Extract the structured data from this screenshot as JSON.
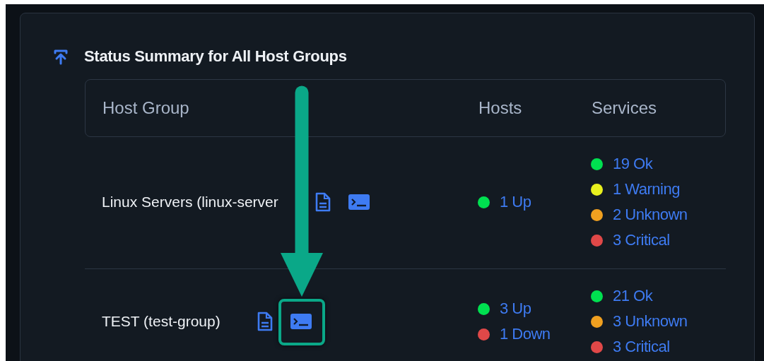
{
  "title": "Status Summary for All Host Groups",
  "columns": [
    "Host Group",
    "Hosts",
    "Services"
  ],
  "rows": [
    {
      "name": "Linux Servers (linux-server",
      "actions": [
        {
          "kind": "document",
          "highlighted": false
        },
        {
          "kind": "terminal",
          "highlighted": false
        }
      ],
      "hosts": [
        {
          "text": "1 Up",
          "color": "#00e050"
        }
      ],
      "services": [
        {
          "text": "19 Ok",
          "color": "#00e050"
        },
        {
          "text": "1 Warning",
          "color": "#e8f01e"
        },
        {
          "text": "2 Unknown",
          "color": "#f0a020"
        },
        {
          "text": "3 Critical",
          "color": "#e04848"
        }
      ]
    },
    {
      "name": "TEST (test-group)",
      "actions": [
        {
          "kind": "document",
          "highlighted": false
        },
        {
          "kind": "terminal",
          "highlighted": true
        }
      ],
      "hosts": [
        {
          "text": "3 Up",
          "color": "#00e050"
        },
        {
          "text": "1 Down",
          "color": "#e04848"
        }
      ],
      "services": [
        {
          "text": "21 Ok",
          "color": "#00e050"
        },
        {
          "text": "3 Unknown",
          "color": "#f0a020"
        },
        {
          "text": "3 Critical",
          "color": "#e04848"
        }
      ]
    }
  ]
}
